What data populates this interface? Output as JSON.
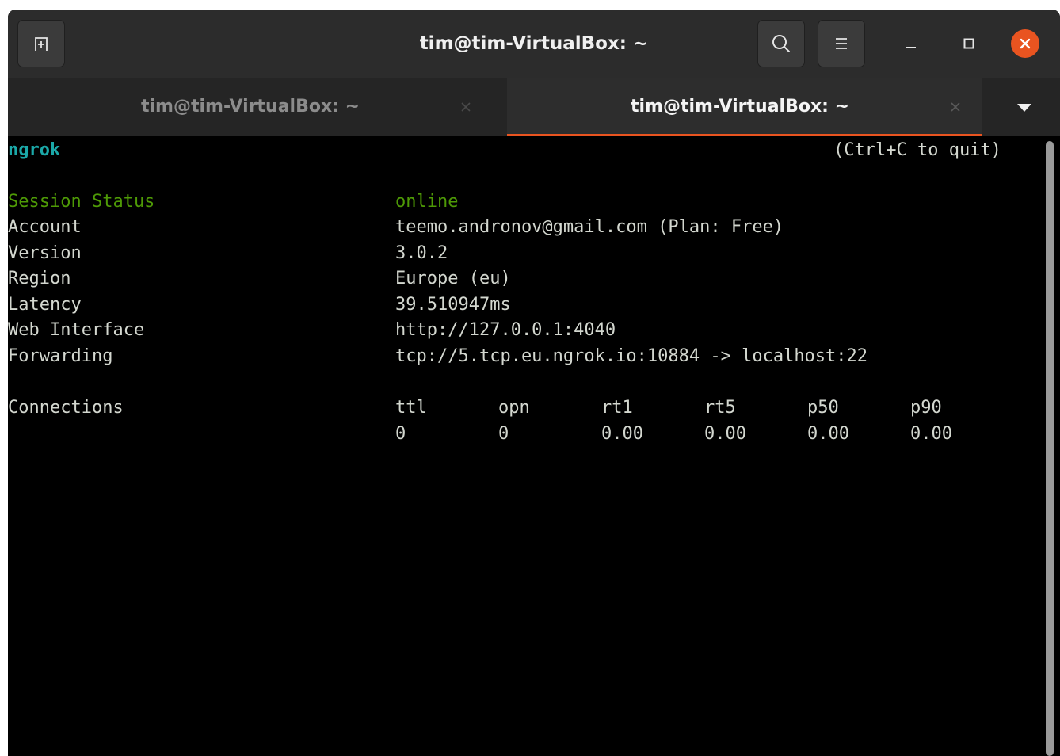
{
  "window": {
    "title": "tim@tim-VirtualBox: ~",
    "accent_color": "#e95420"
  },
  "header_icons": {
    "new_tab": "new-tab-icon",
    "search": "search-icon",
    "menu": "hamburger-menu-icon",
    "minimize": "minimize-icon",
    "maximize": "maximize-icon",
    "close": "close-icon"
  },
  "tabs": [
    {
      "label": "tim@tim-VirtualBox: ~",
      "active": false
    },
    {
      "label": "tim@tim-VirtualBox: ~",
      "active": true
    }
  ],
  "terminal": {
    "app_name": "ngrok",
    "quit_hint": "(Ctrl+C to quit)",
    "session_status": {
      "label": "Session Status",
      "value": "online"
    },
    "rows": [
      {
        "label": "Account",
        "value": "teemo.andronov@gmail.com (Plan: Free)"
      },
      {
        "label": "Version",
        "value": "3.0.2"
      },
      {
        "label": "Region",
        "value": "Europe (eu)"
      },
      {
        "label": "Latency",
        "value": "39.510947ms"
      },
      {
        "label": "Web Interface",
        "value": "http://127.0.0.1:4040"
      },
      {
        "label": "Forwarding",
        "value": "tcp://5.tcp.eu.ngrok.io:10884 -> localhost:22"
      }
    ],
    "connections": {
      "label": "Connections",
      "headers": [
        "ttl",
        "opn",
        "rt1",
        "rt5",
        "p50",
        "p90"
      ],
      "values": [
        "0",
        "0",
        "0.00",
        "0.00",
        "0.00",
        "0.00"
      ]
    }
  }
}
